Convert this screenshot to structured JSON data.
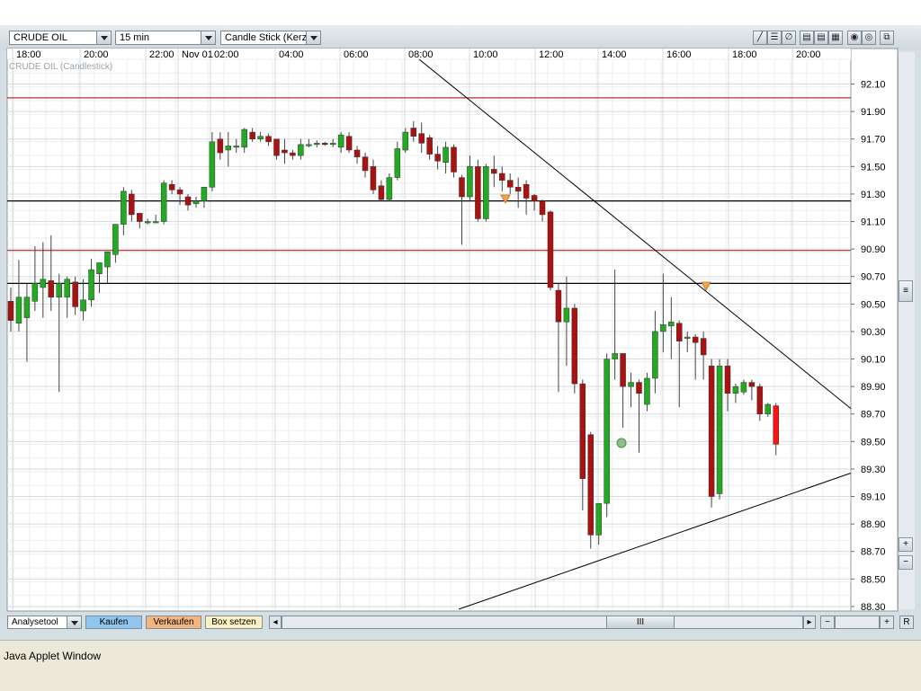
{
  "toolbar": {
    "instrument": "CRUDE OIL",
    "interval": "15 min",
    "chart_type": "Candle Stick (Kerze"
  },
  "chart": {
    "label": "CRUDE OIL (Candlestick)",
    "time_labels": [
      "18:00",
      "20:00",
      "22:00",
      "Nov 01",
      "02:00",
      "04:00",
      "06:00",
      "08:00",
      "10:00",
      "12:00",
      "14:00",
      "16:00",
      "18:00",
      "20:00"
    ],
    "price_labels": [
      "92.10",
      "91.90",
      "91.70",
      "91.50",
      "91.30",
      "91.10",
      "90.90",
      "90.70",
      "90.50",
      "90.30",
      "90.10",
      "89.90",
      "89.70",
      "89.50",
      "89.30",
      "89.10",
      "88.90",
      "88.70",
      "88.50",
      "88.30"
    ],
    "colors": {
      "up": "#22aa22",
      "down": "#aa1111",
      "last": "#ff1111",
      "hline_red": "#b03030",
      "hline_black": "#000000"
    }
  },
  "chart_data": {
    "type": "candlestick",
    "label": "CRUDE OIL (Candlestick)",
    "interval": "15 min",
    "ylim": [
      88.28,
      92.28
    ],
    "horizontal_lines": [
      92.0,
      91.25,
      90.89,
      90.65
    ],
    "trendlines": [
      {
        "from": [
          "08:00",
          92.28
        ],
        "to": [
          "after 20:00",
          89.74
        ]
      },
      {
        "from": [
          "08:30",
          88.28
        ],
        "to": [
          "after 20:00",
          89.27
        ]
      }
    ],
    "candles": [
      {
        "o": 90.52,
        "h": 90.62,
        "l": 90.3,
        "c": 90.38
      },
      {
        "o": 90.36,
        "h": 90.82,
        "l": 90.3,
        "c": 90.55
      },
      {
        "o": 90.4,
        "h": 90.65,
        "l": 90.08,
        "c": 90.55
      },
      {
        "o": 90.52,
        "h": 90.92,
        "l": 90.45,
        "c": 90.65
      },
      {
        "o": 90.62,
        "h": 90.95,
        "l": 90.4,
        "c": 90.68
      },
      {
        "o": 90.67,
        "h": 91.0,
        "l": 90.45,
        "c": 90.55
      },
      {
        "o": 90.55,
        "h": 90.72,
        "l": 89.86,
        "c": 90.65
      },
      {
        "o": 90.55,
        "h": 90.7,
        "l": 90.4,
        "c": 90.68
      },
      {
        "o": 90.66,
        "h": 90.7,
        "l": 90.42,
        "c": 90.48
      },
      {
        "o": 90.45,
        "h": 90.68,
        "l": 90.38,
        "c": 90.53
      },
      {
        "o": 90.53,
        "h": 90.83,
        "l": 90.48,
        "c": 90.75
      },
      {
        "o": 90.72,
        "h": 90.8,
        "l": 90.58,
        "c": 90.8
      },
      {
        "o": 90.77,
        "h": 90.88,
        "l": 90.65,
        "c": 90.88
      },
      {
        "o": 90.86,
        "h": 91.05,
        "l": 90.8,
        "c": 91.08
      },
      {
        "o": 91.08,
        "h": 91.35,
        "l": 91.0,
        "c": 91.32
      },
      {
        "o": 91.3,
        "h": 91.33,
        "l": 91.1,
        "c": 91.15
      },
      {
        "o": 91.16,
        "h": 91.16,
        "l": 91.05,
        "c": 91.1
      },
      {
        "o": 91.1,
        "h": 91.12,
        "l": 91.08,
        "c": 91.1
      },
      {
        "o": 91.1,
        "h": 91.15,
        "l": 91.1,
        "c": 91.1
      },
      {
        "o": 91.1,
        "h": 91.4,
        "l": 91.08,
        "c": 91.38
      },
      {
        "o": 91.37,
        "h": 91.4,
        "l": 91.3,
        "c": 91.33
      },
      {
        "o": 91.33,
        "h": 91.35,
        "l": 91.22,
        "c": 91.3
      },
      {
        "o": 91.28,
        "h": 91.3,
        "l": 91.18,
        "c": 91.22
      },
      {
        "o": 91.23,
        "h": 91.28,
        "l": 91.2,
        "c": 91.25
      },
      {
        "o": 91.25,
        "h": 91.35,
        "l": 91.2,
        "c": 91.35
      },
      {
        "o": 91.35,
        "h": 91.75,
        "l": 91.32,
        "c": 91.68
      },
      {
        "o": 91.7,
        "h": 91.75,
        "l": 91.55,
        "c": 91.6
      },
      {
        "o": 91.62,
        "h": 91.75,
        "l": 91.5,
        "c": 91.65
      },
      {
        "o": 91.65,
        "h": 91.7,
        "l": 91.6,
        "c": 91.65
      },
      {
        "o": 91.64,
        "h": 91.78,
        "l": 91.6,
        "c": 91.77
      },
      {
        "o": 91.75,
        "h": 91.78,
        "l": 91.68,
        "c": 91.7
      },
      {
        "o": 91.7,
        "h": 91.75,
        "l": 91.68,
        "c": 91.72
      },
      {
        "o": 91.72,
        "h": 91.74,
        "l": 91.65,
        "c": 91.68
      },
      {
        "o": 91.7,
        "h": 91.7,
        "l": 91.55,
        "c": 91.58
      },
      {
        "o": 91.62,
        "h": 91.7,
        "l": 91.52,
        "c": 91.6
      },
      {
        "o": 91.6,
        "h": 91.62,
        "l": 91.55,
        "c": 91.58
      },
      {
        "o": 91.58,
        "h": 91.7,
        "l": 91.55,
        "c": 91.66
      },
      {
        "o": 91.66,
        "h": 91.7,
        "l": 91.64,
        "c": 91.66
      },
      {
        "o": 91.66,
        "h": 91.69,
        "l": 91.64,
        "c": 91.67
      },
      {
        "o": 91.67,
        "h": 91.68,
        "l": 91.65,
        "c": 91.66
      },
      {
        "o": 91.66,
        "h": 91.7,
        "l": 91.64,
        "c": 91.67
      },
      {
        "o": 91.64,
        "h": 91.75,
        "l": 91.6,
        "c": 91.73
      },
      {
        "o": 91.72,
        "h": 91.75,
        "l": 91.6,
        "c": 91.62
      },
      {
        "o": 91.62,
        "h": 91.65,
        "l": 91.52,
        "c": 91.57
      },
      {
        "o": 91.57,
        "h": 91.6,
        "l": 91.42,
        "c": 91.47
      },
      {
        "o": 91.5,
        "h": 91.55,
        "l": 91.3,
        "c": 91.33
      },
      {
        "o": 91.36,
        "h": 91.4,
        "l": 91.25,
        "c": 91.26
      },
      {
        "o": 91.26,
        "h": 91.45,
        "l": 91.25,
        "c": 91.42
      },
      {
        "o": 91.42,
        "h": 91.68,
        "l": 91.4,
        "c": 91.63
      },
      {
        "o": 91.62,
        "h": 91.78,
        "l": 91.6,
        "c": 91.75
      },
      {
        "o": 91.78,
        "h": 91.83,
        "l": 91.68,
        "c": 91.72
      },
      {
        "o": 91.74,
        "h": 91.82,
        "l": 91.6,
        "c": 91.67
      },
      {
        "o": 91.71,
        "h": 91.73,
        "l": 91.55,
        "c": 91.59
      },
      {
        "o": 91.59,
        "h": 91.65,
        "l": 91.48,
        "c": 91.54
      },
      {
        "o": 91.53,
        "h": 91.68,
        "l": 91.45,
        "c": 91.64
      },
      {
        "o": 91.64,
        "h": 91.66,
        "l": 91.42,
        "c": 91.46
      },
      {
        "o": 91.42,
        "h": 91.44,
        "l": 90.93,
        "c": 91.28
      },
      {
        "o": 91.28,
        "h": 91.58,
        "l": 91.25,
        "c": 91.5
      },
      {
        "o": 91.5,
        "h": 91.55,
        "l": 91.1,
        "c": 91.12
      },
      {
        "o": 91.12,
        "h": 91.52,
        "l": 91.1,
        "c": 91.5
      },
      {
        "o": 91.48,
        "h": 91.58,
        "l": 91.35,
        "c": 91.45
      },
      {
        "o": 91.45,
        "h": 91.5,
        "l": 91.32,
        "c": 91.4
      },
      {
        "o": 91.4,
        "h": 91.45,
        "l": 91.3,
        "c": 91.35
      },
      {
        "o": 91.35,
        "h": 91.42,
        "l": 91.2,
        "c": 91.32
      },
      {
        "o": 91.37,
        "h": 91.4,
        "l": 91.15,
        "c": 91.27
      },
      {
        "o": 91.29,
        "h": 91.3,
        "l": 91.18,
        "c": 91.25
      },
      {
        "o": 91.25,
        "h": 91.26,
        "l": 91.1,
        "c": 91.15
      },
      {
        "o": 91.17,
        "h": 91.18,
        "l": 90.6,
        "c": 90.62
      },
      {
        "o": 90.6,
        "h": 90.65,
        "l": 89.86,
        "c": 90.37
      },
      {
        "o": 90.37,
        "h": 90.7,
        "l": 90.05,
        "c": 90.47
      },
      {
        "o": 90.47,
        "h": 90.5,
        "l": 89.85,
        "c": 89.92
      },
      {
        "o": 89.92,
        "h": 89.95,
        "l": 89.0,
        "c": 89.23
      },
      {
        "o": 89.55,
        "h": 89.57,
        "l": 88.72,
        "c": 88.82
      },
      {
        "o": 88.82,
        "h": 89.05,
        "l": 88.75,
        "c": 89.05
      },
      {
        "o": 89.05,
        "h": 90.14,
        "l": 88.95,
        "c": 90.1
      },
      {
        "o": 90.1,
        "h": 90.75,
        "l": 89.95,
        "c": 90.14
      },
      {
        "o": 90.14,
        "h": 90.14,
        "l": 89.6,
        "c": 89.9
      },
      {
        "o": 89.9,
        "h": 90.0,
        "l": 89.75,
        "c": 89.93
      },
      {
        "o": 89.93,
        "h": 89.95,
        "l": 89.42,
        "c": 89.85
      },
      {
        "o": 89.77,
        "h": 90.0,
        "l": 89.72,
        "c": 89.96
      },
      {
        "o": 89.96,
        "h": 90.45,
        "l": 89.85,
        "c": 90.3
      },
      {
        "o": 90.3,
        "h": 90.72,
        "l": 90.15,
        "c": 90.35
      },
      {
        "o": 90.34,
        "h": 90.55,
        "l": 90.1,
        "c": 90.37
      },
      {
        "o": 90.36,
        "h": 90.38,
        "l": 89.75,
        "c": 90.23
      },
      {
        "o": 90.25,
        "h": 90.3,
        "l": 90.15,
        "c": 90.26
      },
      {
        "o": 90.26,
        "h": 90.28,
        "l": 89.95,
        "c": 90.22
      },
      {
        "o": 90.25,
        "h": 90.3,
        "l": 89.95,
        "c": 90.13
      },
      {
        "o": 90.05,
        "h": 90.1,
        "l": 89.02,
        "c": 89.1
      },
      {
        "o": 89.12,
        "h": 90.1,
        "l": 89.08,
        "c": 90.05
      },
      {
        "o": 90.05,
        "h": 90.1,
        "l": 89.72,
        "c": 89.85
      },
      {
        "o": 89.85,
        "h": 89.92,
        "l": 89.78,
        "c": 89.9
      },
      {
        "o": 89.86,
        "h": 89.95,
        "l": 89.84,
        "c": 89.93
      },
      {
        "o": 89.93,
        "h": 89.95,
        "l": 89.8,
        "c": 89.9
      },
      {
        "o": 89.9,
        "h": 89.92,
        "l": 89.65,
        "c": 89.7
      },
      {
        "o": 89.7,
        "h": 89.78,
        "l": 89.68,
        "c": 89.77
      },
      {
        "o": 89.76,
        "h": 89.78,
        "l": 89.4,
        "c": 89.48
      }
    ]
  },
  "bottom": {
    "analysetool": "Analysetool",
    "kaufen": "Kaufen",
    "verkaufen": "Verkaufen",
    "box_setzen": "Box setzen",
    "scroll_thumb": "III",
    "minus": "−",
    "plus": "+",
    "r": "R"
  },
  "status": {
    "text": "Java Applet Window"
  }
}
